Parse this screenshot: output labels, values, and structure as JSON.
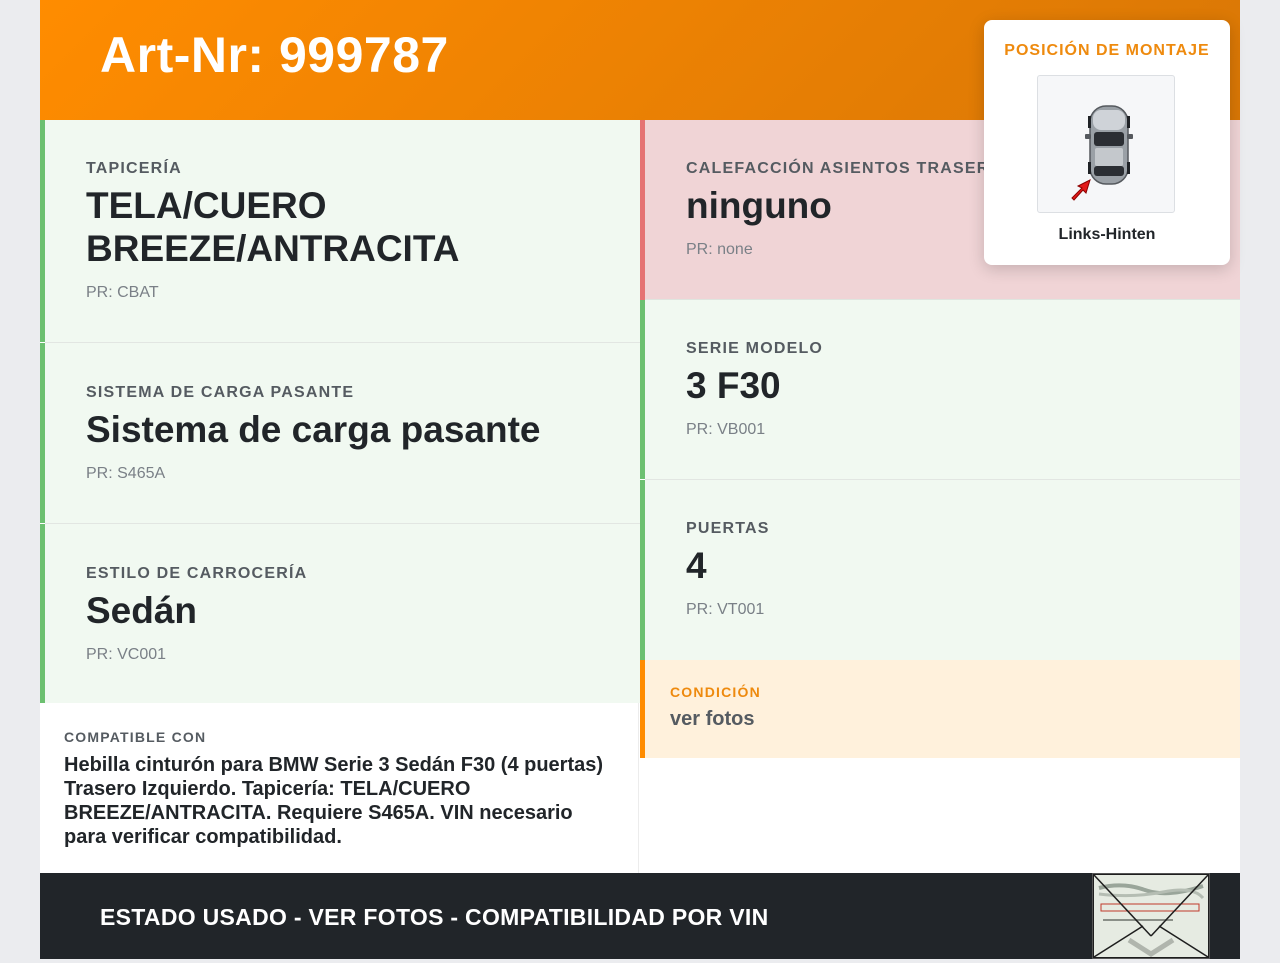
{
  "header": {
    "title": "Art-Nr: 999787"
  },
  "left_cells": [
    {
      "label": "TAPICERÍA",
      "value": "TELA/CUERO BREEZE/ANTRACITA",
      "pr": "PR: CBAT"
    },
    {
      "label": "SISTEMA DE CARGA PASANTE",
      "value": "Sistema de carga pasante",
      "pr": "PR: S465A"
    },
    {
      "label": "ESTILO DE CARROCERÍA",
      "value": "Sedán",
      "pr": "PR: VC001"
    }
  ],
  "right_cells": [
    {
      "label": "CALEFACCIÓN ASIENTOS TRASEROS",
      "value": "ninguno",
      "pr": "PR: none"
    },
    {
      "label": "SERIE MODELO",
      "value": "3 F30",
      "pr": "PR: VB001"
    },
    {
      "label": "PUERTAS",
      "value": "4",
      "pr": "PR: VT001"
    }
  ],
  "compat": {
    "label": "COMPATIBLE CON",
    "text": "Hebilla cinturón para BMW Serie 3 Sedán F30 (4 puertas) Trasero Izquierdo. Tapicería: TELA/CUERO BREEZE/ANTRACITA. Requiere S465A. VIN necesario para verificar compatibilidad."
  },
  "condition": {
    "label": "CONDICIÓN",
    "value": "ver fotos"
  },
  "mount": {
    "label": "POSICIÓN DE MONTAJE",
    "position": "Links-Hinten",
    "icon": "car-top-view-icon"
  },
  "footer": {
    "text": "ESTADO USADO - VER FOTOS - COMPATIBILIDAD POR VIN",
    "thumb_icon": "label-photo-thumbnail"
  },
  "colors": {
    "accent": "#ff8c00",
    "green_bg": "#f1f9f1",
    "green_border": "#6cc070",
    "red_bg": "#f0d4d6",
    "red_border": "#e57373",
    "condition_bg": "#fff1dc",
    "footer_bg": "#212529"
  }
}
